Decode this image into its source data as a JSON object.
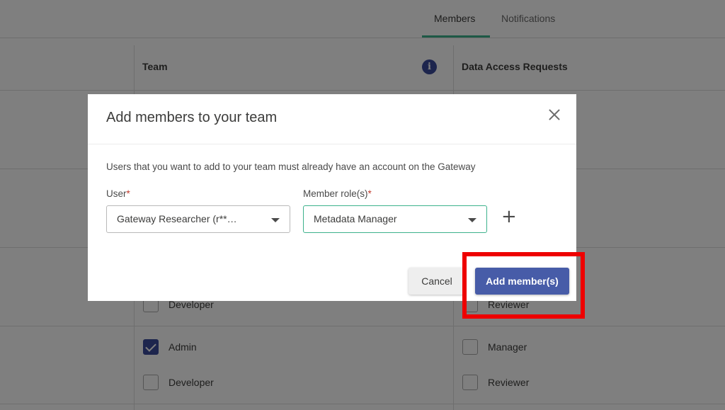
{
  "tabs": {
    "members": "Members",
    "notifications": "Notifications"
  },
  "table": {
    "headers": {
      "team": "Team",
      "data_access": "Data Access Requests"
    },
    "rows": [
      {
        "team_role": "Developer",
        "team_checked": false,
        "dar_role": "Reviewer",
        "dar_checked": false
      },
      {
        "team_role": "Admin",
        "team_checked": true,
        "dar_role": "Manager",
        "dar_checked": false
      },
      {
        "team_role": "Developer",
        "team_checked": false,
        "dar_role": "Reviewer",
        "dar_checked": false
      }
    ]
  },
  "dialog": {
    "title": "Add members to your team",
    "description": "Users that you want to add to your team must already have an account on the Gateway",
    "user_label": "User",
    "user_value": "Gateway Researcher (r**…",
    "role_label": "Member role(s)",
    "role_value": "Metadata Manager",
    "required_marker": "*",
    "cancel_label": "Cancel",
    "add_label": "Add member(s)"
  },
  "icons": {
    "info": "info-icon",
    "close": "close-icon",
    "plus": "plus-icon",
    "caret": "chevron-down-icon"
  },
  "colors": {
    "primary": "#475ca8",
    "accent": "#3db28c",
    "highlight": "#ee0000"
  }
}
